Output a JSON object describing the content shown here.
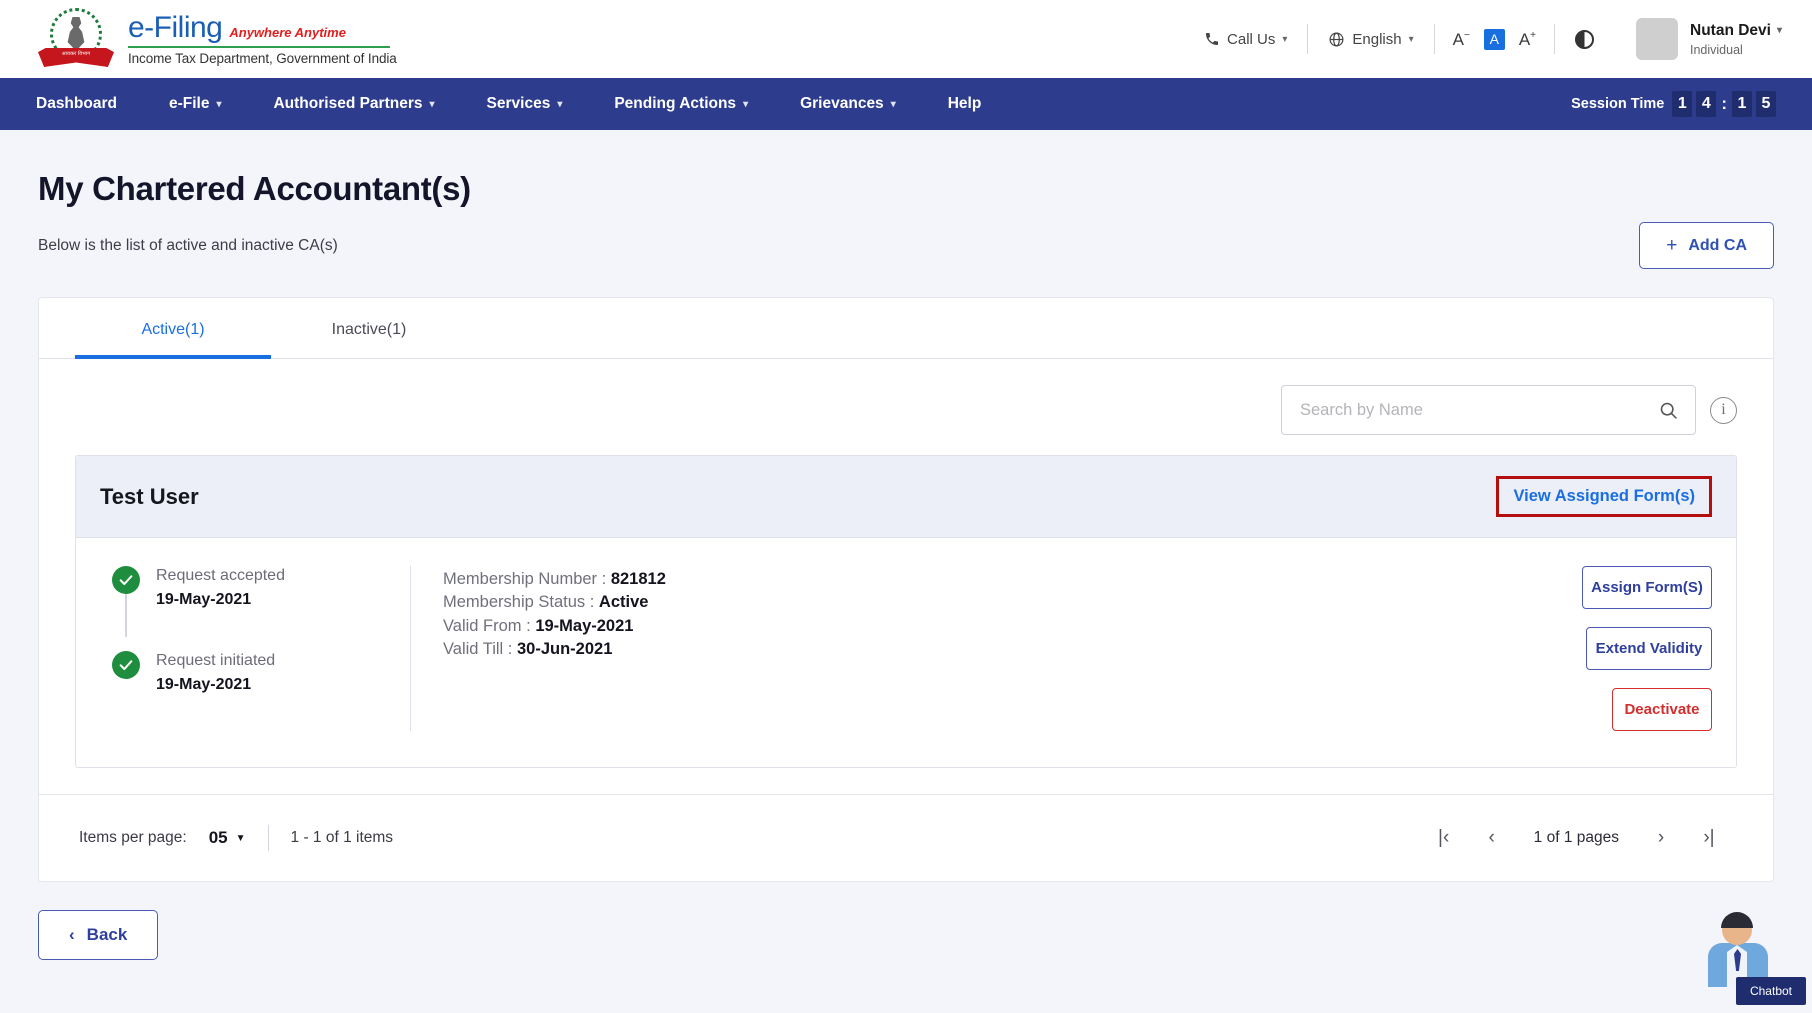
{
  "header": {
    "brand": {
      "efiling": "e-Filing",
      "tagline": "Anywhere Anytime",
      "department": "Income Tax Department, Government of India",
      "emblem_text": "आयकर विभाग"
    },
    "call_us": "Call Us",
    "language": "English",
    "font_decrease": "A",
    "font_normal": "A",
    "font_increase": "A",
    "user_name": "Nutan Devi",
    "user_role": "Individual"
  },
  "nav": {
    "items": [
      {
        "label": "Dashboard",
        "has_caret": false
      },
      {
        "label": "e-File",
        "has_caret": true
      },
      {
        "label": "Authorised Partners",
        "has_caret": true
      },
      {
        "label": "Services",
        "has_caret": true
      },
      {
        "label": "Pending Actions",
        "has_caret": true
      },
      {
        "label": "Grievances",
        "has_caret": true
      },
      {
        "label": "Help",
        "has_caret": false
      }
    ],
    "session_label": "Session Time",
    "session_digits": [
      "1",
      "4",
      "1",
      "5"
    ],
    "session_separator": ":"
  },
  "page": {
    "title": "My Chartered Accountant(s)",
    "subtitle": "Below is the list of active and inactive CA(s)",
    "add_ca_label": "Add CA",
    "add_ca_plus": "+"
  },
  "tabs": [
    {
      "label": "Active(1)",
      "active": true
    },
    {
      "label": "Inactive(1)",
      "active": false
    }
  ],
  "search": {
    "placeholder": "Search by Name",
    "value": "",
    "info_glyph": "i"
  },
  "ca_card": {
    "name": "Test User",
    "view_assigned_label": "View Assigned Form(s)",
    "timeline": [
      {
        "label": "Request accepted",
        "date": "19-May-2021"
      },
      {
        "label": "Request initiated",
        "date": "19-May-2021"
      }
    ],
    "details": [
      {
        "label": "Membership Number :",
        "value": "821812"
      },
      {
        "label": "Membership Status :",
        "value": "Active"
      },
      {
        "label": "Valid From :",
        "value": "19-May-2021"
      },
      {
        "label": "Valid Till :",
        "value": "30-Jun-2021"
      }
    ],
    "actions": [
      {
        "label": "Assign Form(S)",
        "style": "blue"
      },
      {
        "label": "Extend Validity",
        "style": "blue"
      },
      {
        "label": "Deactivate",
        "style": "red"
      }
    ]
  },
  "pagination": {
    "items_per_page_label": "Items per page:",
    "items_per_page_value": "05",
    "range_text": "1 - 1 of 1 items",
    "first_glyph": "|‹",
    "prev_glyph": "‹",
    "pages_text": "1 of 1 pages",
    "next_glyph": "›",
    "last_glyph": "›|"
  },
  "footer": {
    "back_label": "Back",
    "back_glyph": "‹"
  },
  "chatbot": {
    "label": "Chatbot"
  },
  "colors": {
    "nav_blue": "#2d3c8c",
    "accent_blue": "#1a6fe0",
    "outline_blue": "#4a5ab5",
    "danger_red": "#d32f2f",
    "highlight_red": "#b50e0e",
    "success_green": "#1e8e3e",
    "page_bg": "#f4f5fa"
  }
}
